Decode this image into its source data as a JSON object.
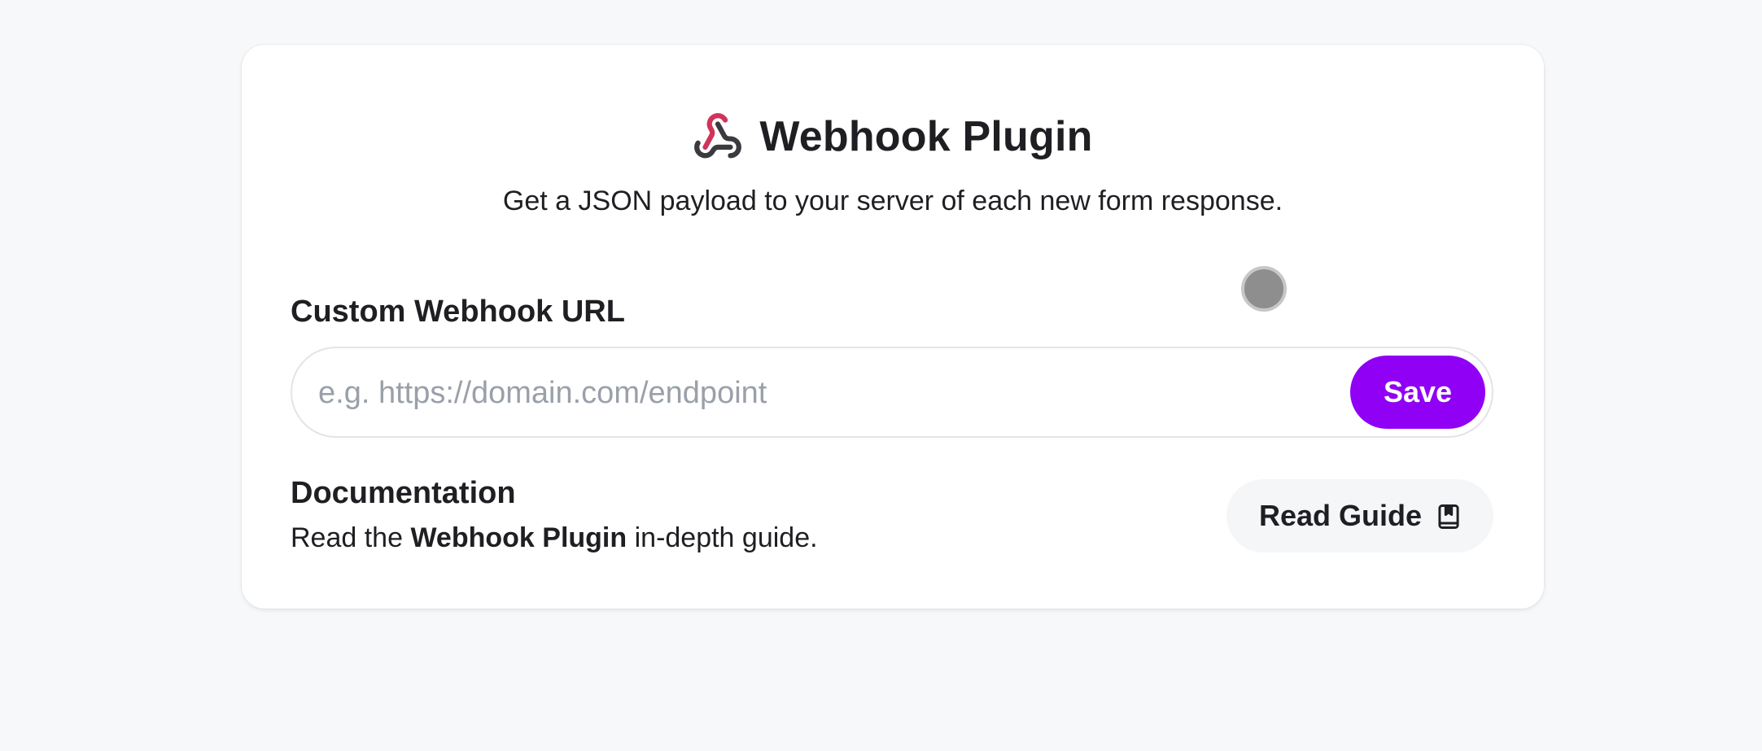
{
  "header": {
    "title": "Webhook Plugin",
    "subtitle": "Get a JSON payload to your server of each new form response.",
    "icon": "webhook-icon"
  },
  "webhook_url": {
    "label": "Custom Webhook URL",
    "value": "",
    "placeholder": "e.g. https://domain.com/endpoint",
    "save_label": "Save"
  },
  "documentation": {
    "title": "Documentation",
    "desc_prefix": "Read the ",
    "desc_bold": "Webhook Plugin",
    "desc_suffix": " in-depth guide.",
    "button_label": "Read Guide",
    "button_icon": "book-icon"
  },
  "colors": {
    "accent": "#9000f5",
    "background": "#f7f8fa",
    "card": "#ffffff",
    "text": "#1f1f23",
    "placeholder": "#9aa0aa"
  }
}
